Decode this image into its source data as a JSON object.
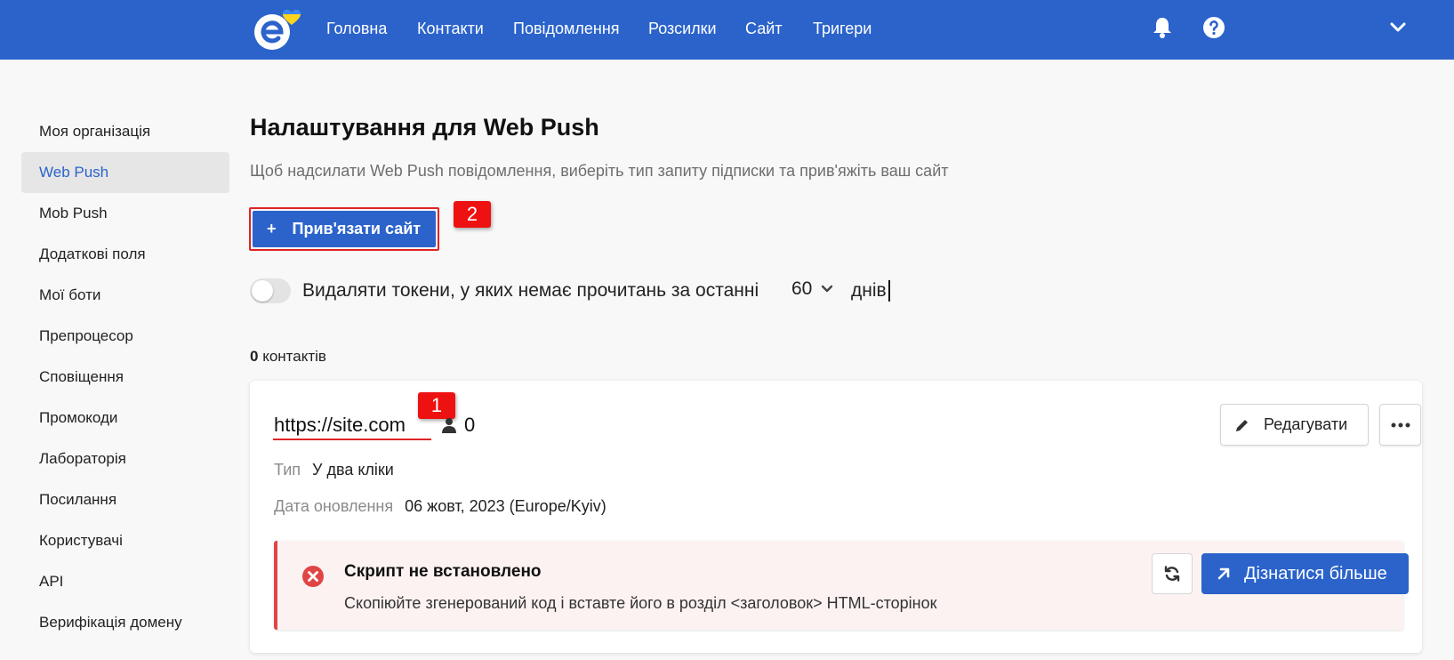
{
  "nav": {
    "items": [
      "Головна",
      "Контакти",
      "Повідомлення",
      "Розсилки",
      "Сайт",
      "Тригери"
    ]
  },
  "sidebar": {
    "items": [
      {
        "label": "Моя організація",
        "active": false
      },
      {
        "label": "Web Push",
        "active": true
      },
      {
        "label": "Mob Push",
        "active": false
      },
      {
        "label": "Додаткові поля",
        "active": false
      },
      {
        "label": "Мої боти",
        "active": false
      },
      {
        "label": "Препроцесор",
        "active": false
      },
      {
        "label": "Сповіщення",
        "active": false
      },
      {
        "label": "Промокоди",
        "active": false
      },
      {
        "label": "Лабораторія",
        "active": false
      },
      {
        "label": "Посилання",
        "active": false
      },
      {
        "label": "Користувачі",
        "active": false
      },
      {
        "label": "API",
        "active": false
      },
      {
        "label": "Верифікація домену",
        "active": false
      }
    ]
  },
  "main": {
    "title": "Налаштування для Web Push",
    "subtitle": "Щоб надсилати Web Push повідомлення, виберіть тип запиту підписки та прив'яжіть ваш сайт",
    "add_site_icon": "+",
    "add_site_label": "Прив'язати сайт",
    "annotation_1": "1",
    "annotation_2": "2",
    "delete_tokens_label": "Видаляти токени, у яких немає прочитань за останні",
    "delete_tokens_enabled": false,
    "days_value": "60",
    "days_unit": "днів",
    "contacts_count": "0",
    "contacts_label": "контактів"
  },
  "site": {
    "url": "https://site.com",
    "subscribers": "0",
    "edit_label": "Редагувати",
    "type_key": "Тип",
    "type_value": "У два кліки",
    "updated_key": "Дата оновлення",
    "updated_value": "06 жовт, 2023 (Europe/Kyiv)",
    "alert_title": "Скрипт не встановлено",
    "alert_text": "Скопіюйте згенерований код і вставте його в розділ <заголовок> HTML-сторінок",
    "learn_more_label": "Дізнатися більше"
  },
  "colors": {
    "brand_blue": "#2b63cb",
    "annotation_red": "#ee1111",
    "error_red": "#e04545"
  },
  "icons": [
    "logo-icon",
    "bell-icon",
    "help-icon",
    "chevron-down-icon",
    "plus-icon",
    "person-icon",
    "pencil-icon",
    "more-icon",
    "error-icon",
    "refresh-icon",
    "arrow-up-right-icon"
  ]
}
